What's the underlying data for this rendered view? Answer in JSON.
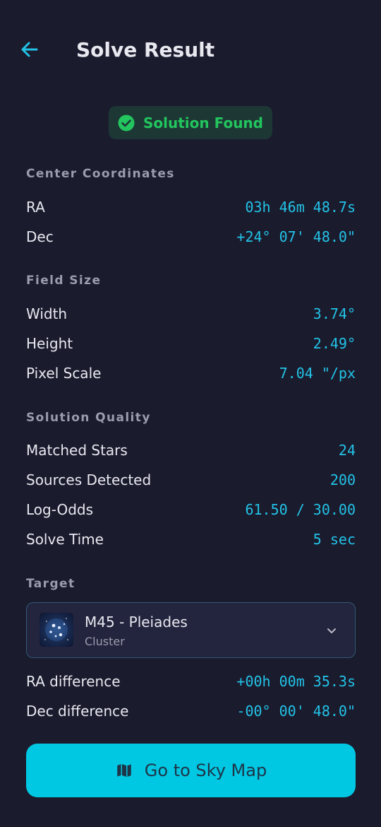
{
  "header": {
    "title": "Solve Result"
  },
  "status": {
    "label": "Solution Found",
    "color": "#22c55e"
  },
  "sections": {
    "center": {
      "title": "Center Coordinates",
      "rows": [
        {
          "label": "RA",
          "value": "03h 46m 48.7s"
        },
        {
          "label": "Dec",
          "value": "+24° 07' 48.0\""
        }
      ]
    },
    "field": {
      "title": "Field Size",
      "rows": [
        {
          "label": "Width",
          "value": "3.74°"
        },
        {
          "label": "Height",
          "value": "2.49°"
        },
        {
          "label": "Pixel Scale",
          "value": "7.04 \"/px"
        }
      ]
    },
    "quality": {
      "title": "Solution Quality",
      "rows": [
        {
          "label": "Matched Stars",
          "value": "24"
        },
        {
          "label": "Sources Detected",
          "value": "200"
        },
        {
          "label": "Log-Odds",
          "value": "61.50 / 30.00"
        },
        {
          "label": "Solve Time",
          "value": "5 sec"
        }
      ]
    },
    "target": {
      "title": "Target",
      "selected": {
        "name": "M45 - Pleiades",
        "type": "Cluster"
      },
      "rows": [
        {
          "label": "RA difference",
          "value": "+00h 00m 35.3s"
        },
        {
          "label": "Dec difference",
          "value": "-00° 00' 48.0\""
        }
      ]
    }
  },
  "action": {
    "label": "Go to Sky Map",
    "color": "#00c8e2"
  },
  "colors": {
    "background": "#1b1b2e",
    "accent": "#22c3e6"
  }
}
